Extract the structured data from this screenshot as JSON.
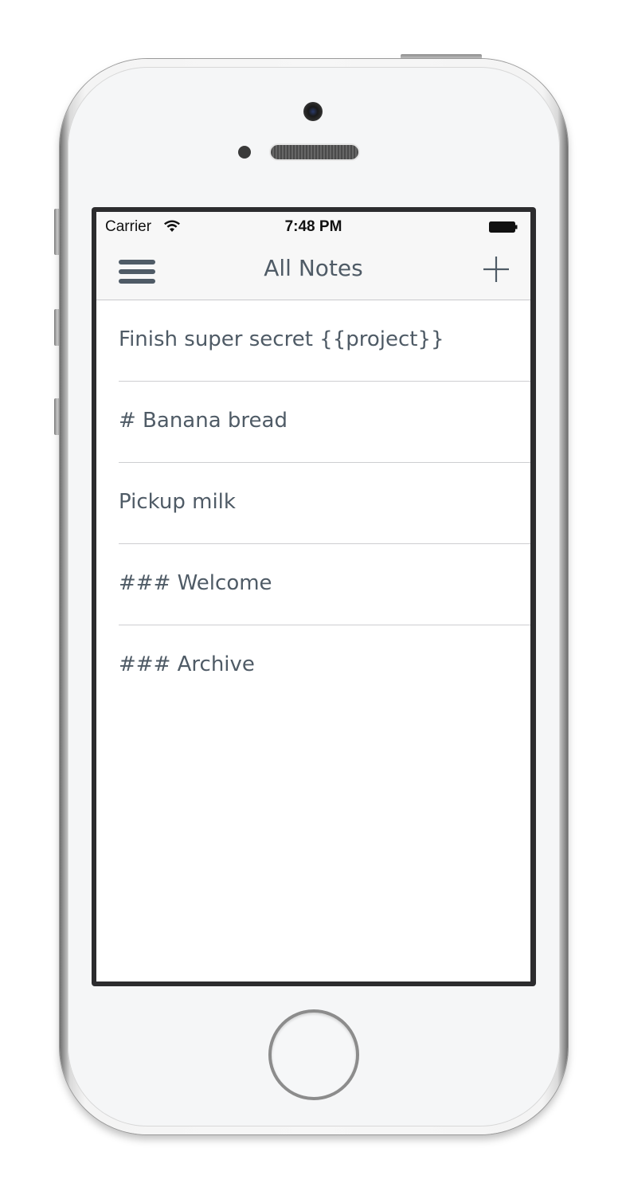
{
  "status_bar": {
    "carrier": "Carrier",
    "time": "7:48 PM"
  },
  "nav_bar": {
    "title": "All Notes",
    "left_icon": "hamburger-menu-icon",
    "right_icon": "plus-icon"
  },
  "notes": [
    {
      "title": "Finish super secret {{project}}"
    },
    {
      "title": "# Banana bread"
    },
    {
      "title": "Pickup milk"
    },
    {
      "title": "### Welcome"
    },
    {
      "title": "### Archive"
    }
  ],
  "colors": {
    "text": "#4f5b66",
    "nav_background": "#f7f7f7",
    "divider": "#cdced1"
  }
}
